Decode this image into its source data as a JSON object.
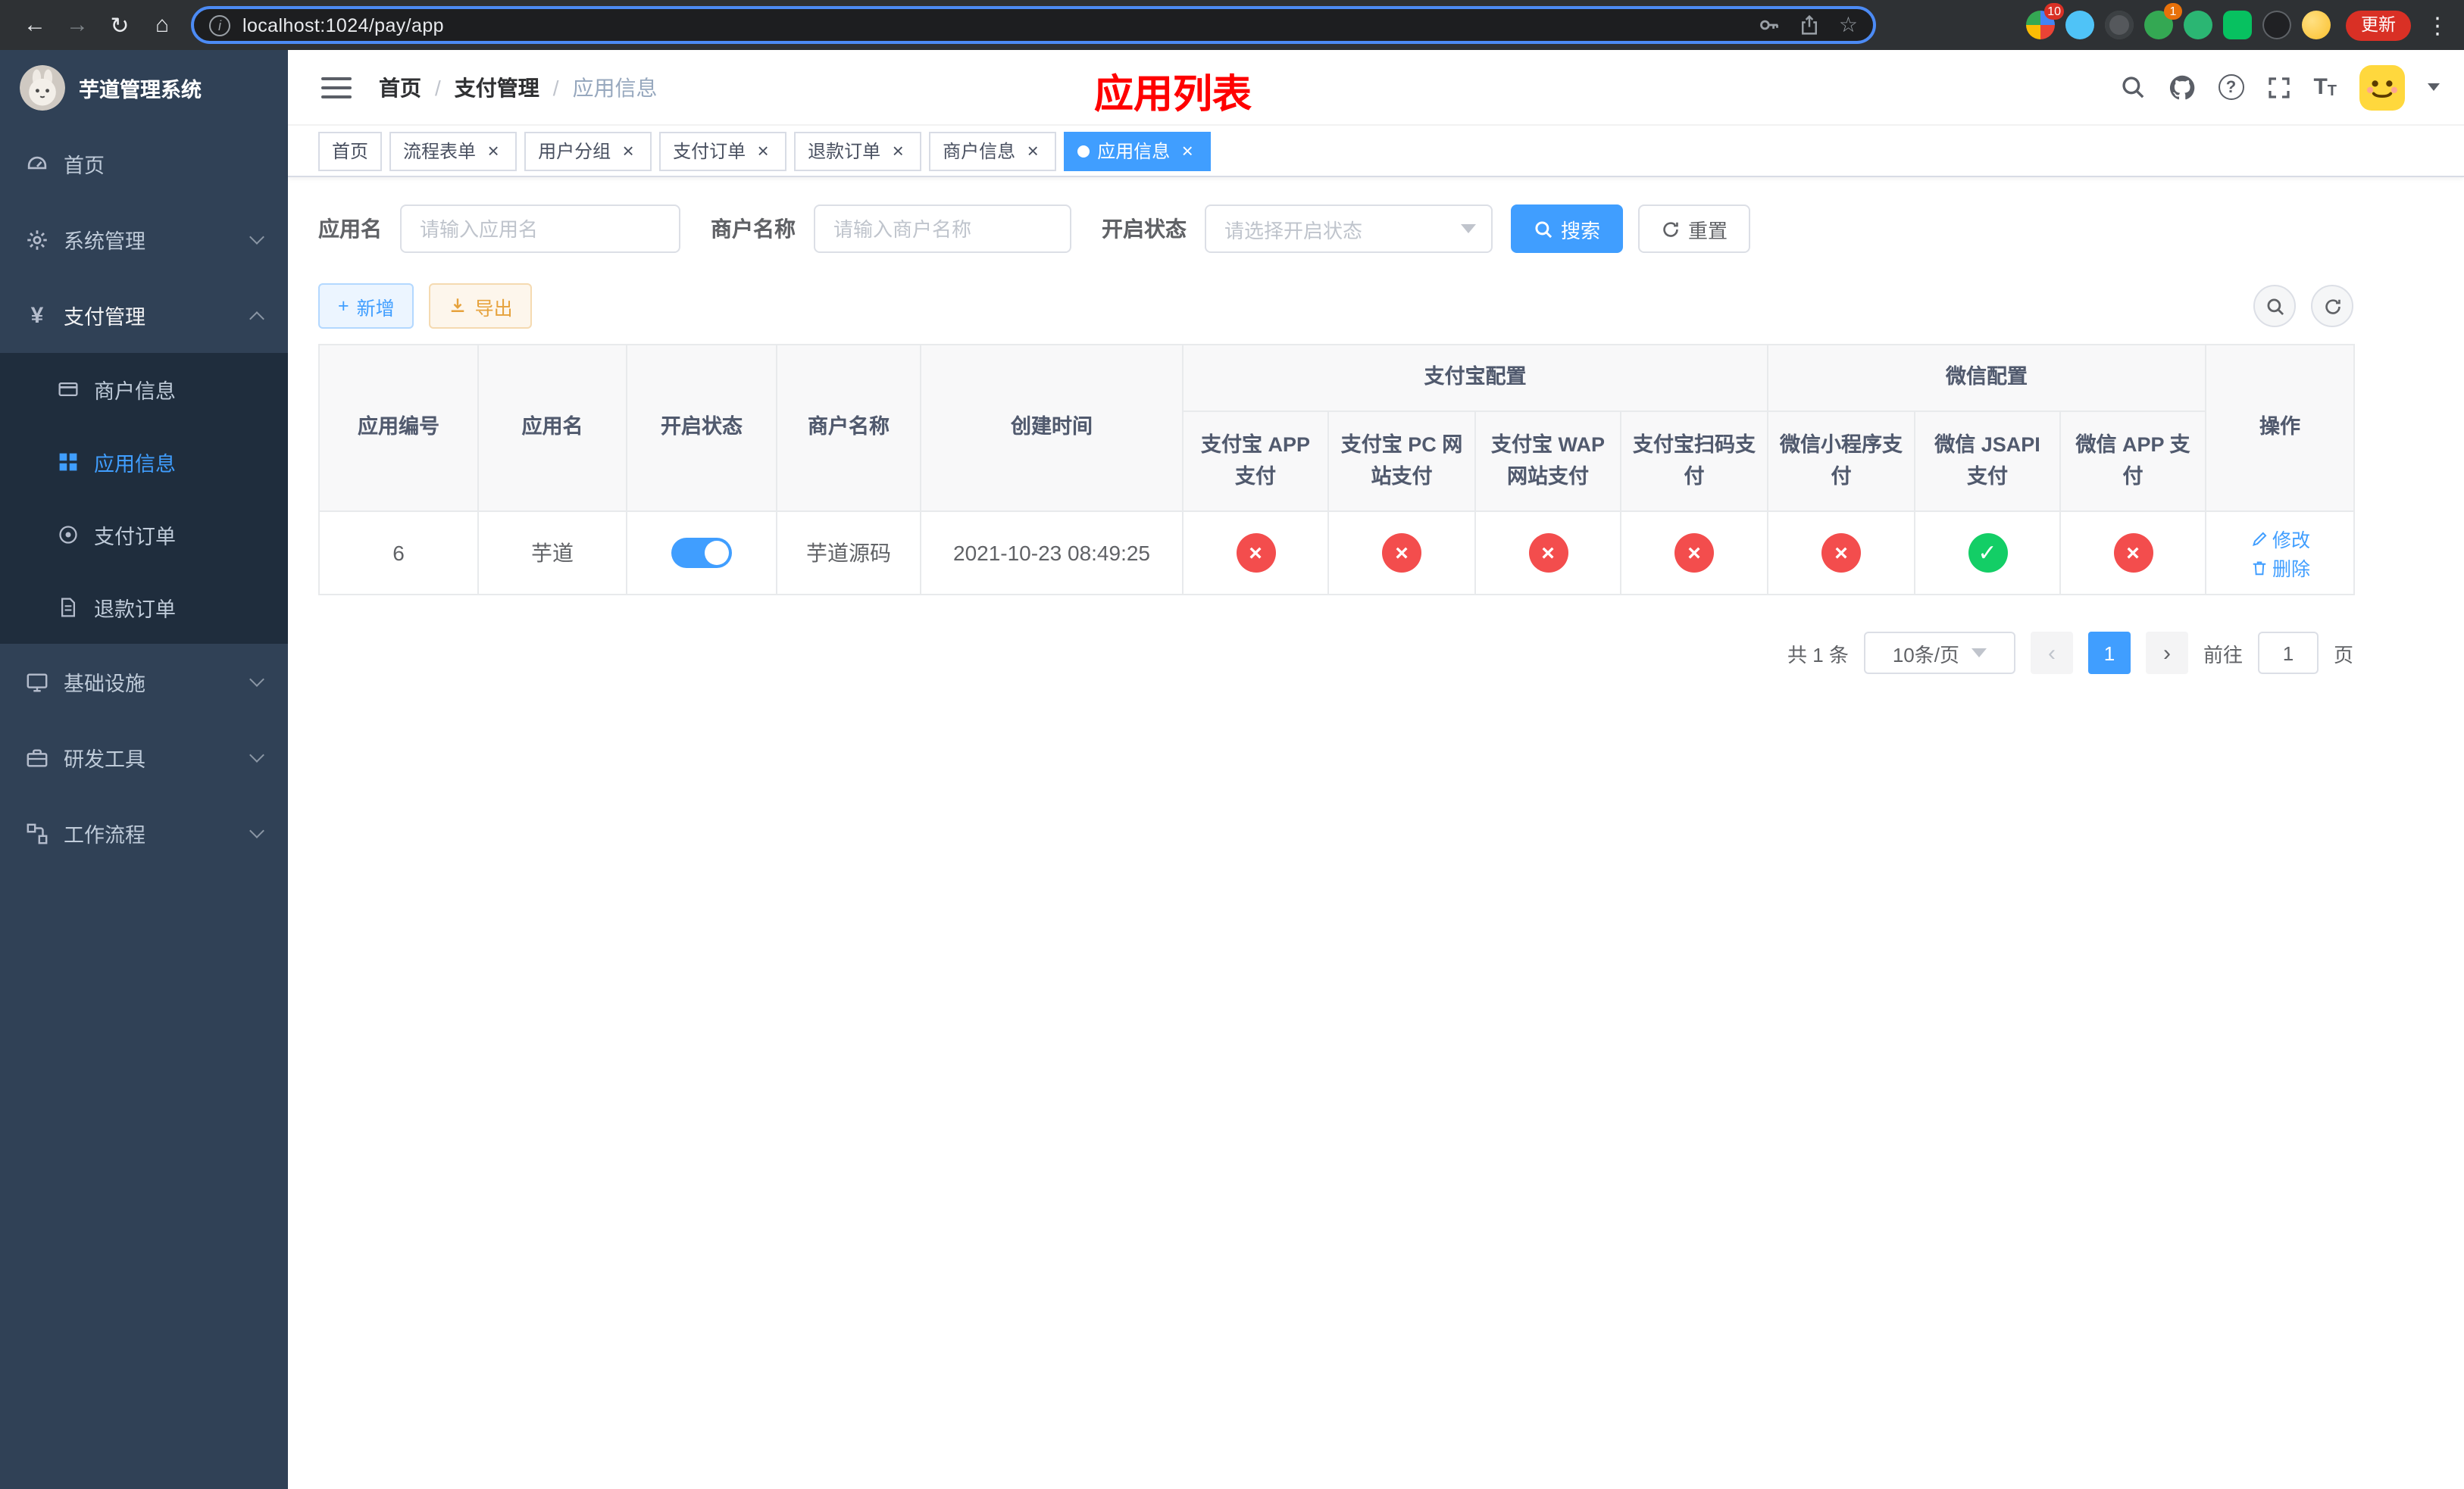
{
  "browser": {
    "url": "localhost:1024/pay/app",
    "update_label": "更新",
    "ext_badge_puzzle": "10",
    "ext_badge_green": "1"
  },
  "icons": {
    "back": "←",
    "forward": "→",
    "reload": "↻",
    "home": "⌂",
    "star": "☆",
    "menu_dots": "⋮",
    "info": "i",
    "question": "?",
    "font_large": "T",
    "font_small": "T",
    "check": "✓",
    "cross": "×",
    "close": "×",
    "prev": "‹",
    "next": "›",
    "plus": "+",
    "yen": "¥",
    "slash": "/"
  },
  "sidebar": {
    "title": "芋道管理系统",
    "items": [
      {
        "label": "首页"
      },
      {
        "label": "系统管理"
      },
      {
        "label": "支付管理",
        "children": [
          {
            "label": "商户信息"
          },
          {
            "label": "应用信息"
          },
          {
            "label": "支付订单"
          },
          {
            "label": "退款订单"
          }
        ]
      },
      {
        "label": "基础设施"
      },
      {
        "label": "研发工具"
      },
      {
        "label": "工作流程"
      }
    ]
  },
  "header": {
    "breadcrumb": [
      "首页",
      "支付管理",
      "应用信息"
    ],
    "banner": "应用列表"
  },
  "tabs": [
    {
      "label": "首页"
    },
    {
      "label": "流程表单"
    },
    {
      "label": "用户分组"
    },
    {
      "label": "支付订单"
    },
    {
      "label": "退款订单"
    },
    {
      "label": "商户信息"
    },
    {
      "label": "应用信息"
    }
  ],
  "filters": {
    "app_name_label": "应用名",
    "app_name_placeholder": "请输入应用名",
    "merchant_label": "商户名称",
    "merchant_placeholder": "请输入商户名称",
    "status_label": "开启状态",
    "status_placeholder": "请选择开启状态",
    "search_label": "搜索",
    "reset_label": "重置"
  },
  "toolbar": {
    "add_label": "新增",
    "export_label": "导出"
  },
  "table": {
    "columns": [
      "应用编号",
      "应用名",
      "开启状态",
      "商户名称",
      "创建时间",
      "操作"
    ],
    "group_headers": {
      "alipay": "支付宝配置",
      "wechat": "微信配置"
    },
    "alipay_columns": [
      "支付宝 APP 支付",
      "支付宝 PC 网站支付",
      "支付宝 WAP 网站支付",
      "支付宝扫码支付"
    ],
    "wechat_columns": [
      "微信小程序支付",
      "微信 JSAPI 支付",
      "微信 APP 支付"
    ],
    "rows": [
      {
        "id": "6",
        "name": "芋道",
        "enabled": true,
        "merchant": "芋道源码",
        "created": "2021-10-23 08:49:25",
        "alipay_app": false,
        "alipay_pc": false,
        "alipay_wap": false,
        "alipay_qr": false,
        "wx_lite": false,
        "wx_jsapi": true,
        "wx_app": false,
        "edit_label": "修改",
        "delete_label": "删除"
      }
    ]
  },
  "pagination": {
    "total_text": "共 1 条",
    "page_size": "10条/页",
    "current_page": "1",
    "goto_prefix": "前往",
    "goto_value": "1",
    "goto_suffix": "页"
  },
  "colors": {
    "accent": "#409eff",
    "success": "#13ce66",
    "danger": "#f34d4d",
    "warning": "#e6a23c",
    "banner_red": "#ff0000",
    "sidebar_bg": "#304156",
    "sidebar_submenu_bg": "#1f2d3d"
  }
}
